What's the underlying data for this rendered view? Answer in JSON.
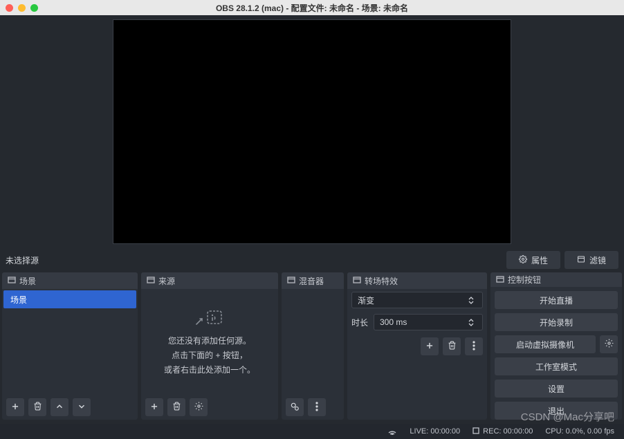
{
  "window": {
    "title": "OBS 28.1.2 (mac) - 配置文件: 未命名 - 场景: 未命名"
  },
  "mid_toolbar": {
    "no_source": "未选择源",
    "properties": "属性",
    "filters": "滤镜"
  },
  "panels": {
    "scenes": {
      "title": "场景",
      "items": [
        "场景"
      ]
    },
    "sources": {
      "title": "来源",
      "empty_line1": "您还没有添加任何源。",
      "empty_line2": "点击下面的 + 按钮，",
      "empty_line3": "或者右击此处添加一个。"
    },
    "mixer": {
      "title": "混音器"
    },
    "transitions": {
      "title": "转场特效",
      "selected": "渐变",
      "duration_label": "时长",
      "duration_value": "300 ms"
    },
    "controls": {
      "title": "控制按钮",
      "start_stream": "开始直播",
      "start_record": "开始录制",
      "virtual_cam": "启动虚拟摄像机",
      "studio_mode": "工作室模式",
      "settings": "设置",
      "exit": "退出"
    }
  },
  "statusbar": {
    "live": "LIVE: 00:00:00",
    "rec": "REC: 00:00:00",
    "cpu": "CPU: 0.0%, 0.00 fps"
  },
  "watermark": "CSDN @Mac分享吧"
}
